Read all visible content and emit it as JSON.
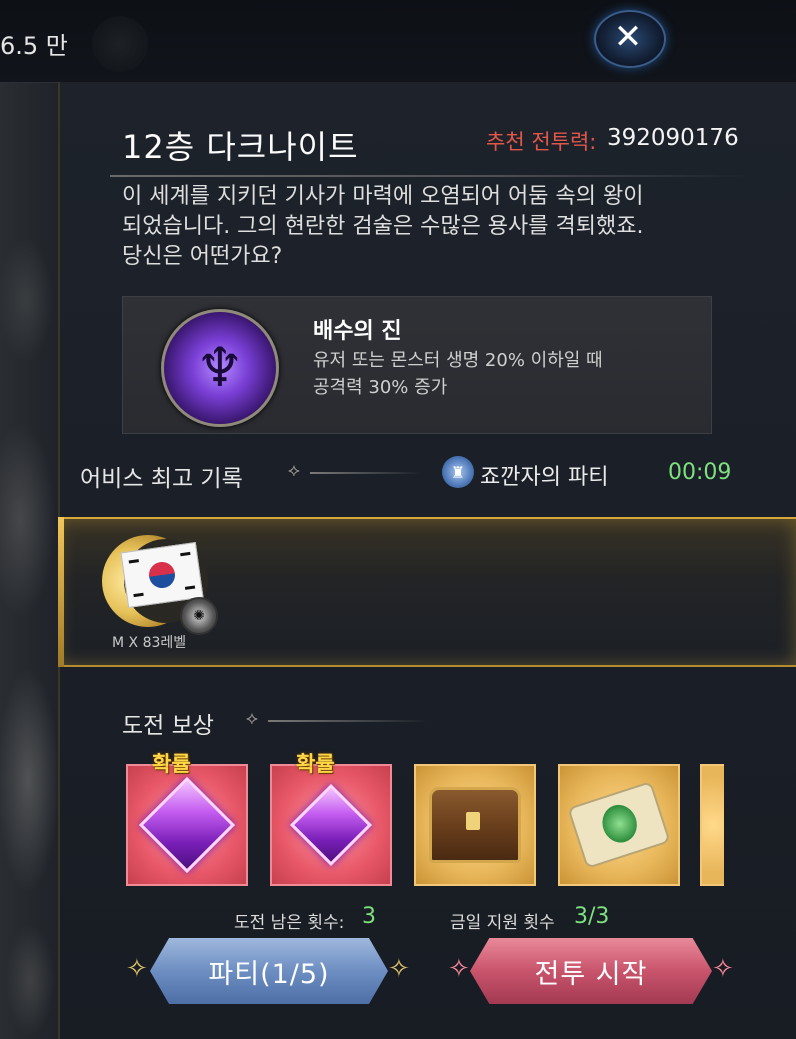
{
  "topbar": {
    "currency_text": "6.5 만",
    "close_label": "✕"
  },
  "dungeon": {
    "title": "12층  다크나이트",
    "recommended_cp_label": "추천 전투력:",
    "recommended_cp_value": "392090176",
    "description": "이 세계를 지키던 기사가 마력에 오염되어 어둠 속의 왕이\n되었습니다. 그의 현란한 검술은 수많은 용사를 격퇴했죠.\n당신은 어떤가요?"
  },
  "buff": {
    "name": "배수의 진",
    "description": "유저 또는 몬스터 생명 20% 이하일 때\n공격력 30% 증가",
    "icon": "berserk-figure-icon"
  },
  "record": {
    "section_title": "어비스 최고 기록",
    "party_name": "죠깐자의 파티",
    "time": "00:09",
    "player_name": "M  X 83레벨"
  },
  "rewards": {
    "section_title": "도전 보상",
    "probability_label": "확률",
    "items": [
      {
        "icon": "purple-gem-icon",
        "rarity": "red",
        "probability": true
      },
      {
        "icon": "purple-gem-shard-icon",
        "rarity": "red",
        "probability": true
      },
      {
        "icon": "treasure-chest-icon",
        "rarity": "gold",
        "probability": false
      },
      {
        "icon": "scroll-icon",
        "rarity": "gold",
        "probability": false
      }
    ]
  },
  "footer": {
    "attempts_label": "도전 남은 횟수:",
    "attempts_value": "3",
    "support_label": "금일 지원 횟수",
    "support_value": "3/3",
    "party_button": "파티(1/5)",
    "start_button": "전투 시작"
  },
  "colors": {
    "accent_gold": "#d6a83c",
    "cp_label_red": "#e2574a",
    "green_value": "#7fe07f",
    "party_button_blue": "#6d8ec2",
    "start_button_pink": "#c9546c"
  }
}
